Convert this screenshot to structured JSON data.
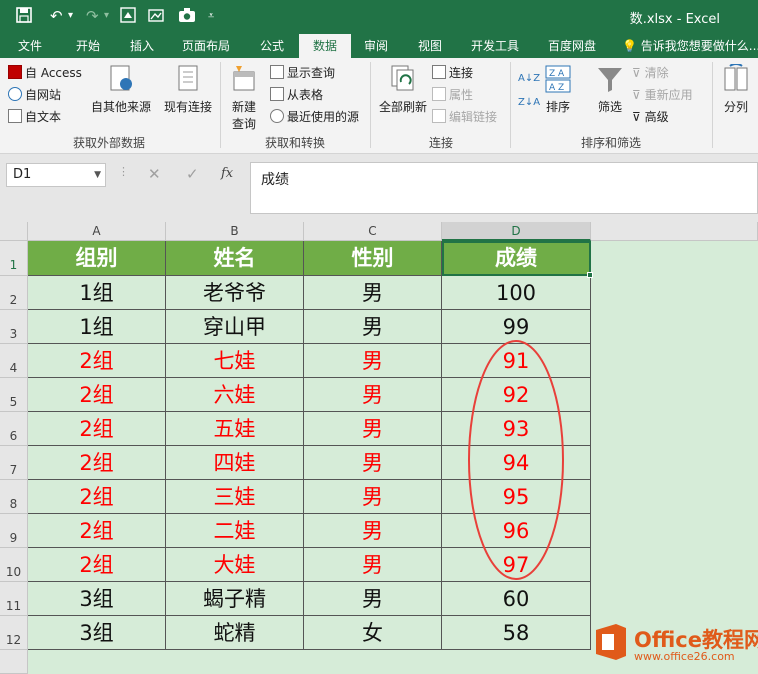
{
  "window": {
    "title": "数.xlsx - Excel"
  },
  "quick_access": [
    {
      "name": "save-icon",
      "glyph": "🖫"
    },
    {
      "name": "undo-icon",
      "glyph": "↶"
    },
    {
      "name": "undo-dropdown-icon",
      "glyph": "▾"
    },
    {
      "name": "redo-icon",
      "glyph": "↷"
    },
    {
      "name": "redo-dropdown-icon",
      "glyph": "▾"
    },
    {
      "name": "screenshot-icon",
      "glyph": "▣"
    },
    {
      "name": "photo-icon",
      "glyph": "◙"
    },
    {
      "name": "camera-icon",
      "glyph": "📷"
    },
    {
      "name": "customize-icon",
      "glyph": "⩡"
    }
  ],
  "tabs": [
    "文件",
    "开始",
    "插入",
    "页面布局",
    "公式",
    "数据",
    "审阅",
    "视图",
    "开发工具",
    "百度网盘"
  ],
  "active_tab": "数据",
  "tell_me": "告诉我您想要做什么...",
  "ribbon": {
    "get_external": {
      "access": "自 Access",
      "web": "自网站",
      "text": "自文本",
      "other_sources": "自其他来源",
      "existing": "现有连接",
      "group_label": "获取外部数据"
    },
    "get_transform": {
      "new_query_1": "新建",
      "new_query_2": "查询",
      "show_queries": "显示查询",
      "from_table": "从表格",
      "recent_sources": "最近使用的源",
      "group_label": "获取和转换"
    },
    "connections": {
      "refresh_all": "全部刷新",
      "connections": "连接",
      "properties": "属性",
      "edit_links": "编辑链接",
      "group_label": "连接"
    },
    "sort_filter": {
      "sort": "排序",
      "filter": "筛选",
      "clear": "清除",
      "reapply": "重新应用",
      "advanced": "高级",
      "group_label": "排序和筛选"
    },
    "data_tools": {
      "text_to_columns": "分列"
    }
  },
  "formula_bar": {
    "name_box": "D1",
    "formula": "成绩",
    "cancel": "✕",
    "enter": "✓",
    "fx": "fx"
  },
  "columns": [
    "A",
    "B",
    "C",
    "D"
  ],
  "selected_column": "D",
  "rows": [
    "1",
    "2",
    "3",
    "4",
    "5",
    "6",
    "7",
    "8",
    "9",
    "10",
    "11",
    "12"
  ],
  "table": {
    "header": [
      "组别",
      "姓名",
      "性别",
      "成绩"
    ],
    "records": [
      {
        "group": "1组",
        "name": "老爷爷",
        "gender": "男",
        "score": "100",
        "highlight": false
      },
      {
        "group": "1组",
        "name": "穿山甲",
        "gender": "男",
        "score": "99",
        "highlight": false
      },
      {
        "group": "2组",
        "name": "七娃",
        "gender": "男",
        "score": "91",
        "highlight": true
      },
      {
        "group": "2组",
        "name": "六娃",
        "gender": "男",
        "score": "92",
        "highlight": true
      },
      {
        "group": "2组",
        "name": "五娃",
        "gender": "男",
        "score": "93",
        "highlight": true
      },
      {
        "group": "2组",
        "name": "四娃",
        "gender": "男",
        "score": "94",
        "highlight": true
      },
      {
        "group": "2组",
        "name": "三娃",
        "gender": "男",
        "score": "95",
        "highlight": true
      },
      {
        "group": "2组",
        "name": "二娃",
        "gender": "男",
        "score": "96",
        "highlight": true
      },
      {
        "group": "2组",
        "name": "大娃",
        "gender": "男",
        "score": "97",
        "highlight": true
      },
      {
        "group": "3组",
        "name": "蝎子精",
        "gender": "男",
        "score": "60",
        "highlight": false
      },
      {
        "group": "3组",
        "name": "蛇精",
        "gender": "女",
        "score": "58",
        "highlight": false
      }
    ]
  },
  "colors": {
    "accent": "#217346",
    "header_fill": "#70ad47",
    "highlight_text": "#ff0000",
    "annotation": "#e8403a",
    "sheet_bg": "#d6ecd8"
  },
  "watermark": {
    "title": "Office教程网",
    "url": "www.office26.com"
  }
}
